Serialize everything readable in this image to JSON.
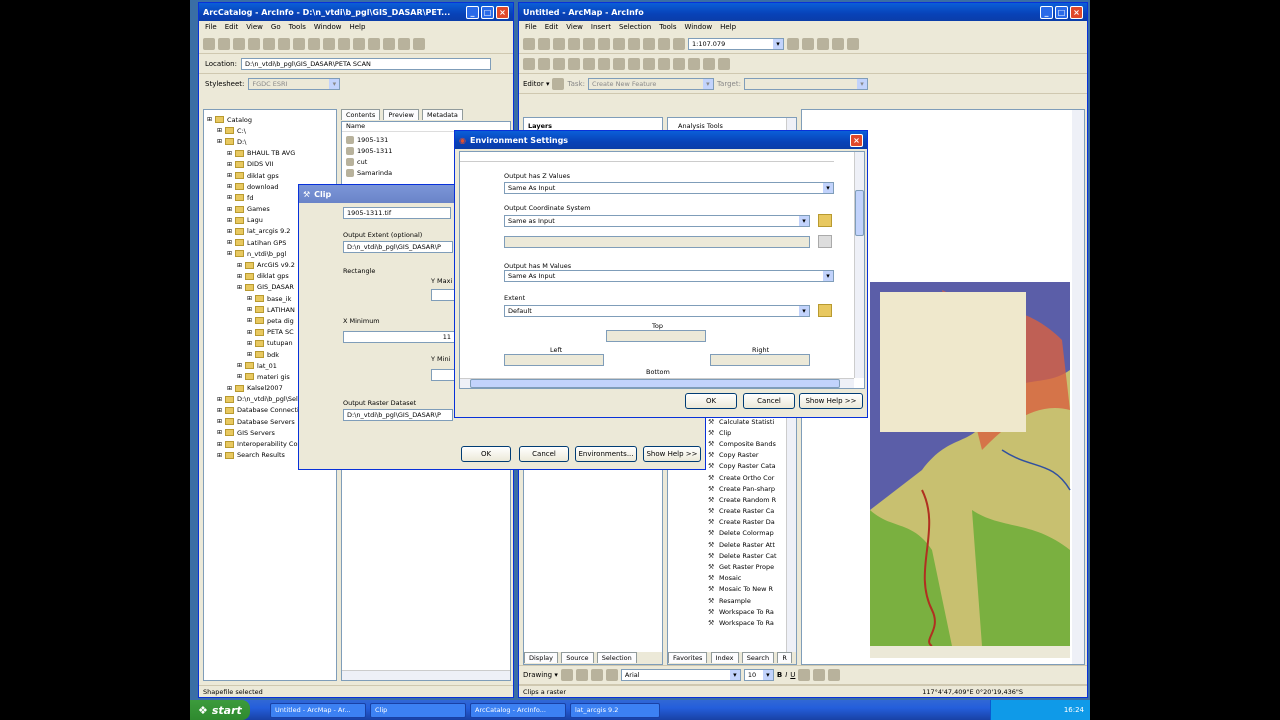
{
  "catalog": {
    "title": "ArcCatalog - ArcInfo - D:\\n_vtdi\\b_pgl\\GIS_DASAR\\PET...",
    "menu": [
      "File",
      "Edit",
      "View",
      "Go",
      "Tools",
      "Window",
      "Help"
    ],
    "location_label": "Location:",
    "location_value": "D:\\n_vtdi\\b_pgl\\GIS_DASAR\\PETA SCAN",
    "stylesheet_label": "Stylesheet:",
    "stylesheet_value": "FGDC ESRI",
    "tree": [
      {
        "label": "Catalog",
        "indent": 0
      },
      {
        "label": "C:\\",
        "indent": 1
      },
      {
        "label": "D:\\",
        "indent": 1
      },
      {
        "label": "BHAUL TB AVG",
        "indent": 2
      },
      {
        "label": "DIDS VII",
        "indent": 2
      },
      {
        "label": "diklat gps",
        "indent": 2
      },
      {
        "label": "download",
        "indent": 2
      },
      {
        "label": "fd",
        "indent": 2
      },
      {
        "label": "Games",
        "indent": 2
      },
      {
        "label": "Lagu",
        "indent": 2
      },
      {
        "label": "lat_arcgis 9.2",
        "indent": 2
      },
      {
        "label": "Latihan GPS",
        "indent": 2
      },
      {
        "label": "n_vtdi\\b_pgl",
        "indent": 2
      },
      {
        "label": "ArcGIS v9.2",
        "indent": 3
      },
      {
        "label": "diklat gps",
        "indent": 3
      },
      {
        "label": "GIS_DASAR",
        "indent": 3
      },
      {
        "label": "base_ik",
        "indent": 4
      },
      {
        "label": "LATIHAN",
        "indent": 4
      },
      {
        "label": "peta dig",
        "indent": 4
      },
      {
        "label": "PETA SC",
        "indent": 4
      },
      {
        "label": "tutupan",
        "indent": 4
      },
      {
        "label": "bdk",
        "indent": 4
      },
      {
        "label": "lat_01",
        "indent": 3
      },
      {
        "label": "materi gis",
        "indent": 3
      },
      {
        "label": "Kalsel2007",
        "indent": 2
      },
      {
        "label": "D:\\n_vtdi\\b_pgl\\Sel",
        "indent": 1
      },
      {
        "label": "Database Connecti",
        "indent": 1
      },
      {
        "label": "Database Servers",
        "indent": 1
      },
      {
        "label": "GIS Servers",
        "indent": 1
      },
      {
        "label": "Interoperability Con",
        "indent": 1
      },
      {
        "label": "Search Results",
        "indent": 1
      }
    ],
    "tabs": [
      "Contents",
      "Preview",
      "Metadata"
    ],
    "list_header": "Name",
    "list_items": [
      "1905-131",
      "1905-1311",
      "cut",
      "Samarinda"
    ],
    "status": "Shapefile selected"
  },
  "arcmap": {
    "title": "Untitled - ArcMap - ArcInfo",
    "menu": [
      "File",
      "Edit",
      "View",
      "Insert",
      "Selection",
      "Tools",
      "Window",
      "Help"
    ],
    "scale": "1:107.079",
    "editor_label": "Editor ▾",
    "task_label": "Task:",
    "task_value": "Create New Feature",
    "target_label": "Target:",
    "layers_label": "Layers",
    "toolbox_label": "Analysis Tools",
    "toc_tabs": [
      "Display",
      "Source",
      "Selection"
    ],
    "tools_tabs": [
      "Favorites",
      "Index",
      "Search",
      "R"
    ],
    "tools": [
      "Calculate Statisti",
      "Clip",
      "Composite Bands",
      "Copy Raster",
      "Copy Raster Cata",
      "Create Ortho Cor",
      "Create Pan-sharp",
      "Create Random R",
      "Create Raster Ca",
      "Create Raster Da",
      "Delete Colormap",
      "Delete Raster Att",
      "Delete Raster Cat",
      "Get Raster Prope",
      "Mosaic",
      "Mosaic To New R",
      "Resample",
      "Workspace To Ra",
      "Workspace To Ra"
    ],
    "drawing_label": "Drawing ▾",
    "font_value": "Arial",
    "font_size": "10",
    "status_left": "Clips a raster",
    "coords": "117°4'47,409\"E  0°20'19,436\"S"
  },
  "clip": {
    "title": "Clip",
    "input_value": "1905-1311.tif",
    "output_extent_label": "Output Extent (optional)",
    "output_extent_value": "D:\\n_vtdi\\b_pgl\\GIS_DASAR\\P",
    "rectangle_label": "Rectangle",
    "ymax_label": "Y Maxi",
    "xmin_label": "X Minimum",
    "xmin_value": "11",
    "ymin_label": "Y Mini",
    "output_raster_label": "Output Raster Dataset",
    "output_raster_value": "D:\\n_vtdi\\b_pgl\\GIS_DASAR\\P",
    "ok": "OK",
    "cancel": "Cancel",
    "environments": "Environments...",
    "show_help": "Show Help >>"
  },
  "env": {
    "title": "Environment Settings",
    "z_label": "Output has Z Values",
    "z_value": "Same As Input",
    "coord_label": "Output Coordinate System",
    "coord_value": "Same as Input",
    "m_label": "Output has M Values",
    "m_value": "Same As Input",
    "extent_label": "Extent",
    "extent_value": "Default",
    "top_label": "Top",
    "left_label": "Left",
    "right_label": "Right",
    "bottom_label": "Bottom",
    "ok": "OK",
    "cancel": "Cancel",
    "show_help": "Show Help >>"
  },
  "taskbar": {
    "start": "start",
    "tasks": [
      "Untitled - ArcMap - Ar...",
      "Clip",
      "ArcCatalog - ArcInfo...",
      "lat_arcgis 9.2"
    ],
    "time": "16:24"
  },
  "colors": {
    "titlebar": "#0a5fd8",
    "face": "#ece9d8",
    "desktop": "#3a6ea5",
    "map_water": "#5b5ea8",
    "map_land": "#c8c070",
    "map_forest": "#7ab040"
  }
}
